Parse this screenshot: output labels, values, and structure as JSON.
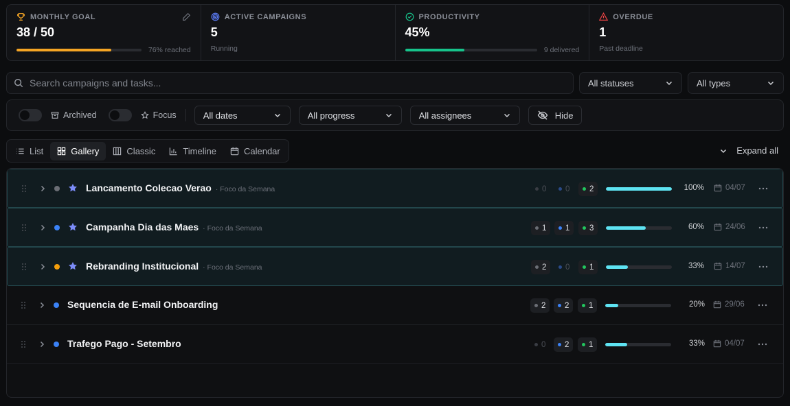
{
  "stats": [
    {
      "label": "MONTHLY GOAL",
      "icon": "trophy-icon",
      "value": "38 / 50",
      "bar_pct": 76,
      "bar_color": "#f5a524",
      "bar_label": "76% reached"
    },
    {
      "label": "ACTIVE CAMPAIGNS",
      "icon": "target-icon",
      "value": "5",
      "sub": "Running"
    },
    {
      "label": "PRODUCTIVITY",
      "icon": "check-circle-icon",
      "value": "45%",
      "bar_pct": 45,
      "bar_color": "#17c38b",
      "bar_label": "9 delivered"
    },
    {
      "label": "OVERDUE",
      "icon": "alert-triangle-icon",
      "value": "1",
      "sub": "Past deadline"
    }
  ],
  "search": {
    "placeholder": "Search campaigns and tasks..."
  },
  "selects": {
    "status": "All statuses",
    "type": "All types"
  },
  "filters": {
    "archived": "Archived",
    "focus": "Focus",
    "dates": "All dates",
    "progress": "All progress",
    "assignees": "All assignees",
    "hide": "Hide"
  },
  "views": [
    {
      "label": "List",
      "icon": "list-icon",
      "active": false
    },
    {
      "label": "Gallery",
      "icon": "grid-icon",
      "active": true
    },
    {
      "label": "Classic",
      "icon": "columns-icon",
      "active": false
    },
    {
      "label": "Timeline",
      "icon": "bar-chart-icon",
      "active": false
    },
    {
      "label": "Calendar",
      "icon": "calendar-icon",
      "active": false
    }
  ],
  "expand_label": "Expand all",
  "colors": {
    "gray": "#6b6e75",
    "blue": "#3b82f6",
    "green": "#22c55e",
    "amber": "#f59e0b",
    "star": "#7c8cf8",
    "progress": "#5ee3f2"
  },
  "campaigns": [
    {
      "title": "Lancamento Colecao Verao",
      "subtitle": "· Foco da Semana",
      "focus": true,
      "dot": "#6b6e75",
      "counts": [
        0,
        0,
        2
      ],
      "progress": 100,
      "progress_label": "100%",
      "date": "04/07"
    },
    {
      "title": "Campanha Dia das Maes",
      "subtitle": "· Foco da Semana",
      "focus": true,
      "dot": "#3b82f6",
      "counts": [
        1,
        1,
        3
      ],
      "progress": 60,
      "progress_label": "60%",
      "date": "24/06"
    },
    {
      "title": "Rebranding Institucional",
      "subtitle": "· Foco da Semana",
      "focus": true,
      "dot": "#f59e0b",
      "counts": [
        2,
        0,
        1
      ],
      "progress": 33,
      "progress_label": "33%",
      "date": "14/07"
    },
    {
      "title": "Sequencia de E-mail Onboarding",
      "subtitle": "",
      "focus": false,
      "dot": "#3b82f6",
      "counts": [
        2,
        2,
        1
      ],
      "progress": 20,
      "progress_label": "20%",
      "date": "29/06"
    },
    {
      "title": "Trafego Pago - Setembro",
      "subtitle": "",
      "focus": false,
      "dot": "#3b82f6",
      "counts": [
        0,
        2,
        1
      ],
      "progress": 33,
      "progress_label": "33%",
      "date": "04/07"
    }
  ]
}
